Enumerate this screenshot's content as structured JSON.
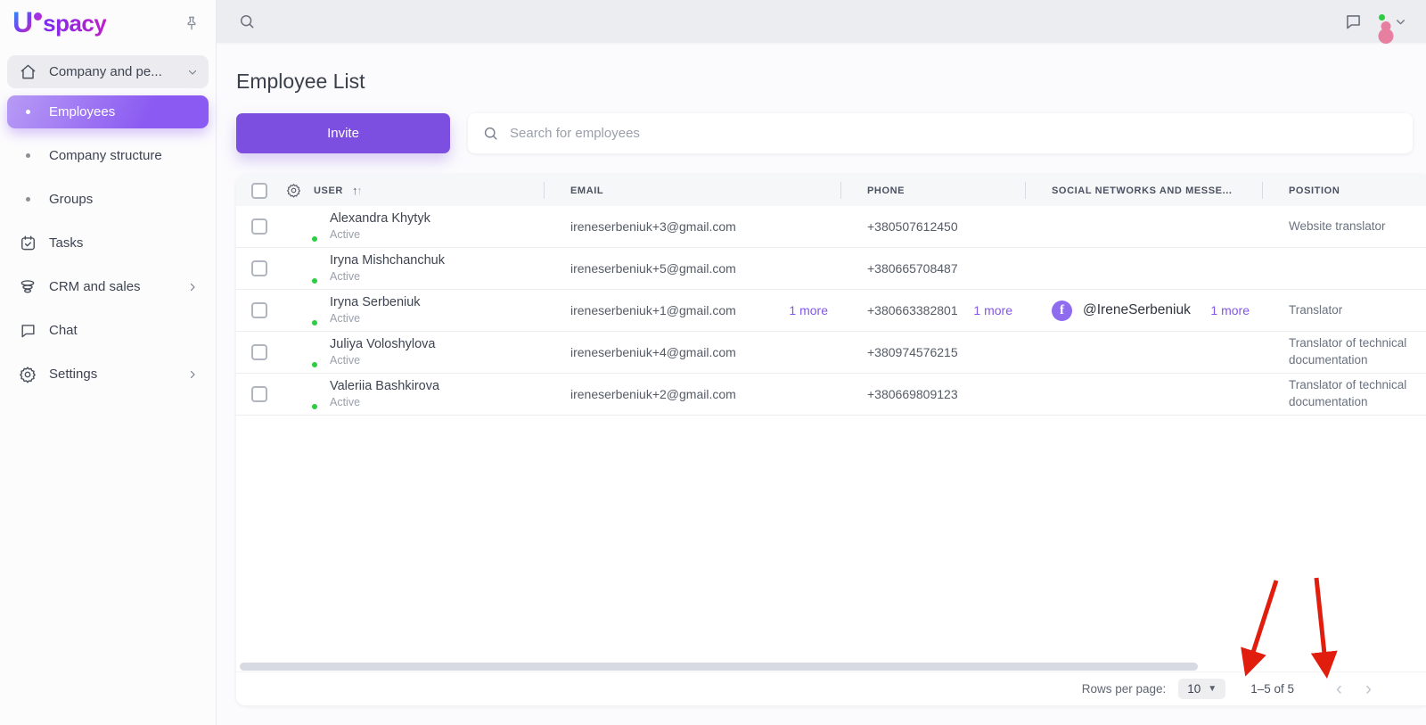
{
  "brand": {
    "name_u": "U",
    "name_rest": "spacy"
  },
  "sidebar": {
    "items": [
      {
        "label": "Company and pe..."
      },
      {
        "label": "Employees"
      },
      {
        "label": "Company structure"
      },
      {
        "label": "Groups"
      },
      {
        "label": "Tasks"
      },
      {
        "label": "CRM and sales"
      },
      {
        "label": "Chat"
      },
      {
        "label": "Settings"
      }
    ]
  },
  "header": {
    "title": "Employee List",
    "invite_label": "Invite",
    "search_placeholder": "Search for employees"
  },
  "table": {
    "columns": {
      "user": "USER",
      "email": "EMAIL",
      "phone": "PHONE",
      "social": "SOCIAL NETWORKS AND MESSE...",
      "position": "POSITION"
    },
    "rows": [
      {
        "name": "Alexandra Khytyk",
        "status": "Active",
        "email": "ireneserbeniuk+3@gmail.com",
        "phone": "+380507612450",
        "position": "Website translator"
      },
      {
        "name": "Iryna Mishchanchuk",
        "status": "Active",
        "email": "ireneserbeniuk+5@gmail.com",
        "phone": "+380665708487",
        "position": ""
      },
      {
        "name": "Iryna Serbeniuk",
        "status": "Active",
        "email": "ireneserbeniuk+1@gmail.com",
        "email_more": "1 more",
        "phone": "+380663382801",
        "phone_more": "1 more",
        "social_handle": "@IreneSerbeniuk",
        "social_more": "1 more",
        "position": "Translator"
      },
      {
        "name": "Juliya Voloshylova",
        "status": "Active",
        "email": "ireneserbeniuk+4@gmail.com",
        "phone": "+380974576215",
        "position_line1": "Translator of technical",
        "position_line2": "documentation"
      },
      {
        "name": "Valeriia Bashkirova",
        "status": "Active",
        "email": "ireneserbeniuk+2@gmail.com",
        "phone": "+380669809123",
        "position_line1": "Translator of technical",
        "position_line2": "documentation"
      }
    ]
  },
  "pagination": {
    "rows_per_page_label": "Rows per page:",
    "rows_per_page_value": "10",
    "range_label": "1–5 of 5"
  },
  "colors": {
    "accent_purple": "#7c4fe0",
    "active_gradient_start": "#b79bf5",
    "active_gradient_end": "#8b5af2",
    "link_purple": "#8257e5",
    "facebook_purple": "#8f6cef",
    "online_green": "#2ecc40",
    "annotation_red": "#e11d0e",
    "topbar_gray": "#ebedf1"
  }
}
